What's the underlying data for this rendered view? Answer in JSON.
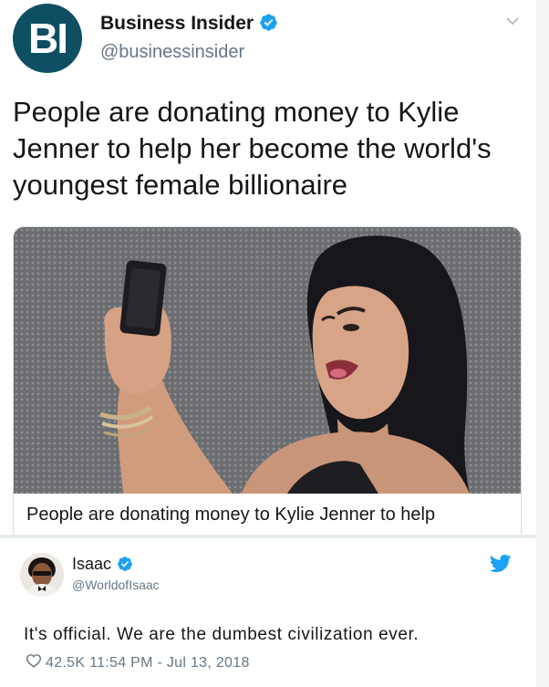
{
  "top_tweet": {
    "logo_text": "BI",
    "name": "Business Insider",
    "handle": "@businessinsider",
    "text": "People are donating money to Kylie Jenner to help her become the world's youngest female billionaire",
    "card_title": "People are donating money to Kylie Jenner to help"
  },
  "bottom_tweet": {
    "name": "Isaac",
    "handle": "@WorldofIsaac",
    "text": "It's official. We are the dumbest civilization ever.",
    "likes": "42.5K",
    "timestamp": "11:54 PM - Jul 13, 2018"
  },
  "colors": {
    "logo_bg": "#0f4f63",
    "verified": "#1da1f2",
    "secondary_text": "#657786",
    "twitter_bird": "#1da1f2"
  },
  "icons": [
    "verified-badge-icon",
    "chevron-down-icon",
    "twitter-bird-icon",
    "heart-icon"
  ]
}
